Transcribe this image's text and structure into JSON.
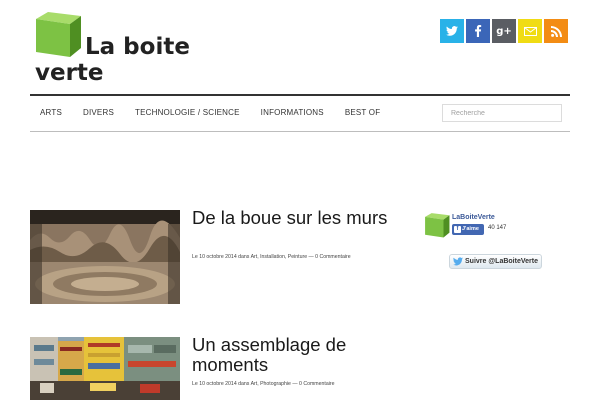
{
  "site": {
    "logo_line1": "La boite",
    "logo_line2": "verte",
    "logo_color": "#7dc244"
  },
  "social": [
    {
      "name": "twitter",
      "icon": "twitter-icon",
      "color": "#29b2e8",
      "glyph": "🐦"
    },
    {
      "name": "facebook",
      "icon": "facebook-icon",
      "color": "#3b66b8",
      "glyph": "f"
    },
    {
      "name": "google-plus",
      "icon": "google-plus-icon",
      "color": "#5a5d63",
      "glyph": "g+"
    },
    {
      "name": "email",
      "icon": "email-icon",
      "color": "#f0dc14",
      "glyph": "✉"
    },
    {
      "name": "rss",
      "icon": "rss-icon",
      "color": "#f38c14",
      "glyph": "◣"
    }
  ],
  "nav": {
    "items": [
      "ARTS",
      "DIVERS",
      "TECHNOLOGIE / SCIENCE",
      "INFORMATIONS",
      "BEST OF"
    ],
    "search_placeholder": "Recherche"
  },
  "articles": [
    {
      "title": "De la boue sur les murs",
      "meta_prefix": "Le 10 octobre 2014 dans ",
      "categories": "Art, Installation, Peinture",
      "comments": "0 Commentaire"
    },
    {
      "title": "Un assemblage de moments",
      "meta_prefix": "Le 10 octobre 2014 dans ",
      "categories": "Art, Photographie",
      "comments": "0 Commentaire"
    }
  ],
  "sidebar": {
    "fb_name": "LaBoiteVerte",
    "fb_like": "J'aime",
    "fb_count": "40 147",
    "twitter_follow": "Suivre @LaBoiteVerte"
  }
}
